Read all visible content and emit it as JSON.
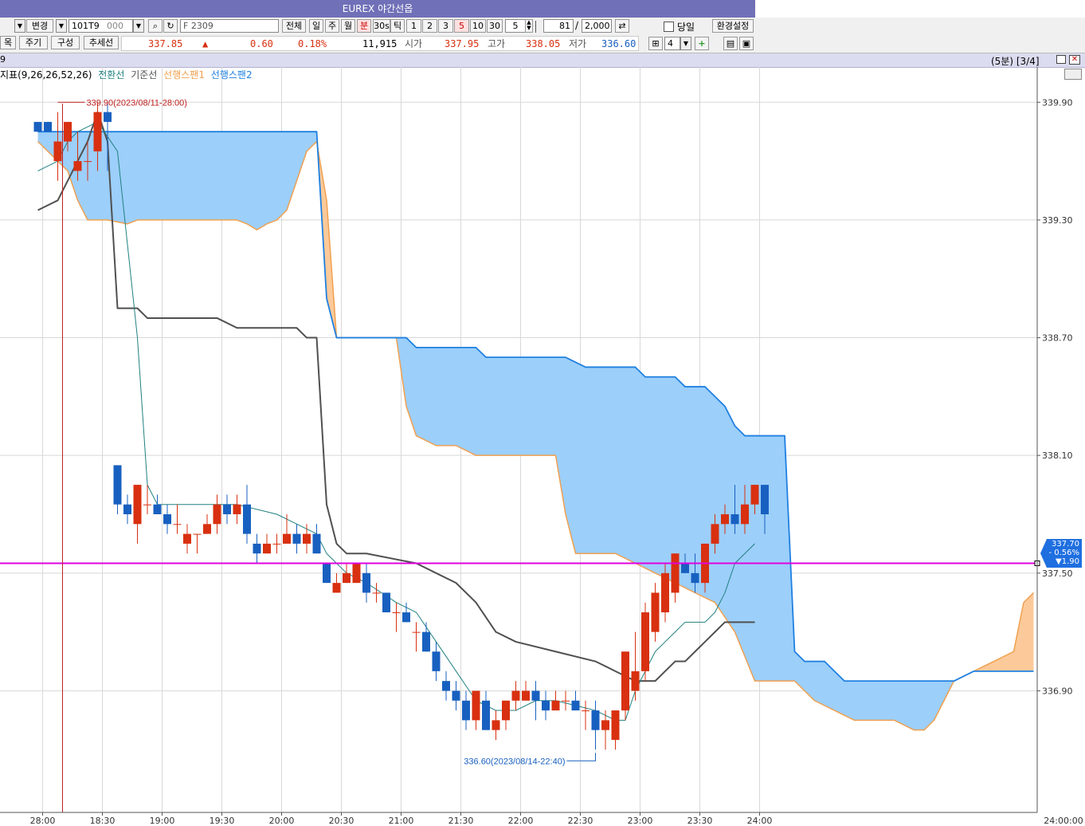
{
  "window": {
    "title": "EUREX 야간선옵"
  },
  "toolbar1": {
    "change_label": "변경",
    "code": "101T9",
    "code_suffix": "000",
    "contract": "F 2309",
    "all_label": "전체",
    "day_label": "일",
    "week_label": "주",
    "month_label": "월",
    "minute_label": "분",
    "sec30_label": "30s",
    "tick_label": "틱",
    "intervals": [
      "1",
      "2",
      "3",
      "5",
      "10",
      "30"
    ],
    "selected_interval": "5",
    "period_value": "5",
    "count_value": "81",
    "count_separator": "/",
    "total_value": "2,000",
    "sameday_label": "당일",
    "settings_label": "환경설정"
  },
  "toolbar2": {
    "item_label": "목",
    "period_label": "주기",
    "compose_label": "구성",
    "trend_label": "추세선",
    "price": "337.85",
    "direction_icon": "up-triangle",
    "change": "0.60",
    "change_pct": "0.18%",
    "volume": "11,915",
    "open_label": "시가",
    "open": "337.95",
    "high_label": "고가",
    "high": "338.05",
    "low_label": "저가",
    "low": "336.60",
    "layout_count": "4"
  },
  "chartbar": {
    "left_label": "9",
    "interval_info": "(5분) [3/4]"
  },
  "legend": {
    "indicator": "지표(9,26,26,52,26)",
    "conversion": "전환선",
    "base": "기준선",
    "span1": "선행스팬1",
    "span2": "선행스팬2"
  },
  "colors": {
    "up": "#d83010",
    "down": "#1860c0",
    "conversion": "#208080",
    "base": "#505050",
    "span1": "#f0a050",
    "span2": "#1f80e0",
    "cloud_bull": "#9ccffa",
    "cloud_bear": "#fcca9a",
    "hline": "#e000e0"
  },
  "annotations": {
    "high_label": "339.90(2023/08/11-28:00)",
    "low_label": "336.60(2023/08/14-22:40)"
  },
  "price_tag": {
    "price": "337.70",
    "pct": "- 0.56%",
    "change": "▼1.90"
  },
  "chart_data": {
    "type": "candlestick",
    "y_ticks": [
      "339.90",
      "339.30",
      "338.70",
      "338.10",
      "337.50",
      "336.90"
    ],
    "y_range": [
      336.28,
      340.08
    ],
    "x_ticks": [
      "28:00",
      "18:30",
      "19:00",
      "19:30",
      "20:00",
      "20:30",
      "21:00",
      "21:30",
      "22:00",
      "22:30",
      "23:00",
      "23:30",
      "24:00",
      "24:00:00"
    ],
    "hline": 337.55,
    "candles": [
      [
        339.8,
        339.8,
        339.75,
        339.75
      ],
      [
        339.8,
        339.8,
        339.75,
        339.75
      ],
      [
        339.6,
        339.85,
        339.5,
        339.7
      ],
      [
        339.7,
        339.8,
        339.65,
        339.8
      ],
      [
        339.55,
        339.75,
        339.5,
        339.6
      ],
      [
        339.6,
        339.7,
        339.5,
        339.6
      ],
      [
        339.65,
        339.9,
        339.55,
        339.85
      ],
      [
        339.85,
        339.9,
        339.55,
        339.8
      ],
      [
        338.05,
        338.05,
        337.8,
        337.85
      ],
      [
        337.85,
        337.9,
        337.75,
        337.8
      ],
      [
        337.75,
        337.95,
        337.65,
        337.95
      ],
      [
        337.85,
        337.95,
        337.8,
        337.85
      ],
      [
        337.85,
        337.9,
        337.8,
        337.8
      ],
      [
        337.8,
        337.85,
        337.7,
        337.75
      ],
      [
        337.75,
        337.85,
        337.7,
        337.75
      ],
      [
        337.65,
        337.75,
        337.6,
        337.7
      ],
      [
        337.7,
        337.7,
        337.6,
        337.7
      ],
      [
        337.7,
        337.8,
        337.7,
        337.75
      ],
      [
        337.75,
        337.9,
        337.7,
        337.85
      ],
      [
        337.85,
        337.9,
        337.75,
        337.8
      ],
      [
        337.8,
        337.9,
        337.75,
        337.85
      ],
      [
        337.85,
        337.95,
        337.65,
        337.7
      ],
      [
        337.65,
        337.7,
        337.55,
        337.6
      ],
      [
        337.6,
        337.7,
        337.6,
        337.65
      ],
      [
        337.65,
        337.7,
        337.6,
        337.65
      ],
      [
        337.65,
        337.8,
        337.65,
        337.7
      ],
      [
        337.7,
        337.75,
        337.6,
        337.65
      ],
      [
        337.65,
        337.75,
        337.6,
        337.7
      ],
      [
        337.7,
        337.75,
        337.6,
        337.6
      ],
      [
        337.55,
        337.55,
        337.45,
        337.45
      ],
      [
        337.4,
        337.5,
        337.4,
        337.45
      ],
      [
        337.45,
        337.55,
        337.45,
        337.5
      ],
      [
        337.45,
        337.55,
        337.45,
        337.55
      ],
      [
        337.5,
        337.55,
        337.35,
        337.4
      ],
      [
        337.4,
        337.45,
        337.35,
        337.4
      ],
      [
        337.4,
        337.4,
        337.3,
        337.3
      ],
      [
        337.3,
        337.35,
        337.2,
        337.3
      ],
      [
        337.3,
        337.35,
        337.25,
        337.25
      ],
      [
        337.2,
        337.25,
        337.1,
        337.2
      ],
      [
        337.2,
        337.25,
        337.1,
        337.1
      ],
      [
        337.1,
        337.15,
        336.95,
        337.0
      ],
      [
        336.95,
        337.0,
        336.85,
        336.9
      ],
      [
        336.9,
        336.95,
        336.8,
        336.85
      ],
      [
        336.85,
        336.9,
        336.7,
        336.75
      ],
      [
        336.75,
        336.9,
        336.7,
        336.9
      ],
      [
        336.85,
        336.9,
        336.7,
        336.7
      ],
      [
        336.7,
        336.8,
        336.65,
        336.75
      ],
      [
        336.75,
        336.85,
        336.7,
        336.85
      ],
      [
        336.85,
        336.95,
        336.8,
        336.9
      ],
      [
        336.85,
        336.95,
        336.85,
        336.9
      ],
      [
        336.9,
        336.95,
        336.75,
        336.85
      ],
      [
        336.85,
        336.9,
        336.75,
        336.8
      ],
      [
        336.8,
        336.9,
        336.8,
        336.85
      ],
      [
        336.85,
        336.9,
        336.8,
        336.85
      ],
      [
        336.85,
        336.9,
        336.8,
        336.8
      ],
      [
        336.8,
        336.85,
        336.7,
        336.8
      ],
      [
        336.8,
        336.85,
        336.6,
        336.7
      ],
      [
        336.7,
        336.8,
        336.6,
        336.75
      ],
      [
        336.65,
        336.8,
        336.6,
        336.8
      ],
      [
        336.8,
        337.1,
        336.75,
        337.1
      ],
      [
        336.9,
        337.2,
        336.85,
        337.0
      ],
      [
        337.0,
        337.35,
        336.95,
        337.3
      ],
      [
        337.2,
        337.45,
        337.15,
        337.4
      ],
      [
        337.3,
        337.55,
        337.25,
        337.5
      ],
      [
        337.4,
        337.6,
        337.35,
        337.6
      ],
      [
        337.55,
        337.6,
        337.5,
        337.5
      ],
      [
        337.5,
        337.6,
        337.4,
        337.45
      ],
      [
        337.45,
        337.65,
        337.4,
        337.65
      ],
      [
        337.65,
        337.8,
        337.6,
        337.75
      ],
      [
        337.75,
        337.85,
        337.7,
        337.8
      ],
      [
        337.8,
        337.95,
        337.7,
        337.75
      ],
      [
        337.75,
        337.95,
        337.7,
        337.85
      ],
      [
        337.85,
        337.95,
        337.8,
        337.95
      ],
      [
        337.95,
        337.95,
        337.7,
        337.8
      ]
    ],
    "conversion": [
      [
        0,
        339.55
      ],
      [
        2,
        339.6
      ],
      [
        3,
        339.7
      ],
      [
        4,
        339.75
      ],
      [
        6,
        339.8
      ],
      [
        8,
        339.65
      ],
      [
        10,
        338.7
      ],
      [
        11,
        337.95
      ],
      [
        12,
        337.85
      ],
      [
        20,
        337.85
      ],
      [
        24,
        337.8
      ],
      [
        26,
        337.75
      ],
      [
        28,
        337.7
      ],
      [
        29,
        337.6
      ],
      [
        31,
        337.5
      ],
      [
        33,
        337.45
      ],
      [
        36,
        337.35
      ],
      [
        38,
        337.3
      ],
      [
        40,
        337.15
      ],
      [
        42,
        337.0
      ],
      [
        44,
        336.85
      ],
      [
        46,
        336.8
      ],
      [
        48,
        336.8
      ],
      [
        50,
        336.85
      ],
      [
        52,
        336.85
      ],
      [
        56,
        336.8
      ],
      [
        58,
        336.75
      ],
      [
        59,
        336.75
      ],
      [
        60,
        336.9
      ],
      [
        61,
        337.0
      ],
      [
        62,
        337.1
      ],
      [
        63,
        337.15
      ],
      [
        64,
        337.2
      ],
      [
        65,
        337.25
      ],
      [
        66,
        337.25
      ],
      [
        67,
        337.25
      ],
      [
        68,
        337.3
      ],
      [
        69,
        337.4
      ],
      [
        70,
        337.55
      ],
      [
        71,
        337.6
      ],
      [
        72,
        337.65
      ]
    ],
    "base": [
      [
        0,
        339.35
      ],
      [
        2,
        339.4
      ],
      [
        3,
        339.5
      ],
      [
        4,
        339.6
      ],
      [
        5,
        339.7
      ],
      [
        6,
        339.85
      ],
      [
        7,
        339.7
      ],
      [
        8,
        338.85
      ],
      [
        9,
        338.85
      ],
      [
        10,
        338.85
      ],
      [
        11,
        338.8
      ],
      [
        12,
        338.8
      ],
      [
        18,
        338.8
      ],
      [
        20,
        338.75
      ],
      [
        25,
        338.75
      ],
      [
        26,
        338.75
      ],
      [
        27,
        338.7
      ],
      [
        28,
        338.7
      ],
      [
        29,
        337.85
      ],
      [
        30,
        337.65
      ],
      [
        31,
        337.6
      ],
      [
        33,
        337.6
      ],
      [
        38,
        337.55
      ],
      [
        40,
        337.5
      ],
      [
        42,
        337.45
      ],
      [
        44,
        337.35
      ],
      [
        46,
        337.2
      ],
      [
        48,
        337.15
      ],
      [
        52,
        337.1
      ],
      [
        56,
        337.05
      ],
      [
        58,
        337.0
      ],
      [
        60,
        336.95
      ],
      [
        61,
        336.95
      ],
      [
        62,
        336.95
      ],
      [
        63,
        337.0
      ],
      [
        64,
        337.05
      ],
      [
        65,
        337.05
      ],
      [
        66,
        337.1
      ],
      [
        67,
        337.15
      ],
      [
        68,
        337.2
      ],
      [
        69,
        337.25
      ],
      [
        70,
        337.25
      ],
      [
        71,
        337.25
      ],
      [
        72,
        337.25
      ]
    ],
    "span1": [
      [
        0,
        339.7
      ],
      [
        2,
        339.6
      ],
      [
        3,
        339.55
      ],
      [
        4,
        339.4
      ],
      [
        5,
        339.3
      ],
      [
        7,
        339.3
      ],
      [
        9,
        339.28
      ],
      [
        10,
        339.3
      ],
      [
        14,
        339.3
      ],
      [
        18,
        339.3
      ],
      [
        19,
        339.3
      ],
      [
        20,
        339.3
      ],
      [
        21,
        339.28
      ],
      [
        22,
        339.25
      ],
      [
        23,
        339.28
      ],
      [
        24,
        339.3
      ],
      [
        25,
        339.35
      ],
      [
        26,
        339.5
      ],
      [
        27,
        339.65
      ],
      [
        28,
        339.7
      ],
      [
        29,
        339.4
      ],
      [
        30,
        338.7
      ],
      [
        31,
        338.7
      ],
      [
        36,
        338.7
      ],
      [
        37,
        338.35
      ],
      [
        38,
        338.2
      ],
      [
        40,
        338.15
      ],
      [
        42,
        338.15
      ],
      [
        44,
        338.1
      ],
      [
        46,
        338.1
      ],
      [
        48,
        338.1
      ],
      [
        52,
        338.1
      ],
      [
        53,
        337.8
      ],
      [
        54,
        337.6
      ],
      [
        56,
        337.6
      ],
      [
        58,
        337.6
      ],
      [
        60,
        337.55
      ],
      [
        62,
        337.5
      ],
      [
        64,
        337.45
      ],
      [
        66,
        337.4
      ],
      [
        68,
        337.35
      ],
      [
        70,
        337.2
      ],
      [
        72,
        336.95
      ],
      [
        74,
        336.95
      ],
      [
        76,
        336.95
      ],
      [
        78,
        336.85
      ],
      [
        80,
        336.8
      ],
      [
        82,
        336.75
      ],
      [
        84,
        336.75
      ],
      [
        86,
        336.75
      ],
      [
        88,
        336.7
      ],
      [
        89,
        336.7
      ],
      [
        90,
        336.75
      ],
      [
        91,
        336.85
      ],
      [
        92,
        336.95
      ],
      [
        94,
        337.0
      ],
      [
        96,
        337.05
      ],
      [
        98,
        337.1
      ],
      [
        99,
        337.35
      ],
      [
        100,
        337.4
      ]
    ],
    "span2": [
      [
        0,
        339.75
      ],
      [
        28,
        339.75
      ],
      [
        29,
        338.9
      ],
      [
        30,
        338.7
      ],
      [
        31,
        338.7
      ],
      [
        32,
        338.7
      ],
      [
        33,
        338.7
      ],
      [
        36,
        338.7
      ],
      [
        37,
        338.7
      ],
      [
        38,
        338.65
      ],
      [
        39,
        338.65
      ],
      [
        44,
        338.65
      ],
      [
        45,
        338.6
      ],
      [
        48,
        338.6
      ],
      [
        53,
        338.6
      ],
      [
        55,
        338.55
      ],
      [
        57,
        338.55
      ],
      [
        60,
        338.55
      ],
      [
        61,
        338.5
      ],
      [
        62,
        338.5
      ],
      [
        64,
        338.5
      ],
      [
        65,
        338.45
      ],
      [
        66,
        338.45
      ],
      [
        67,
        338.45
      ],
      [
        68,
        338.4
      ],
      [
        69,
        338.35
      ],
      [
        70,
        338.25
      ],
      [
        71,
        338.2
      ],
      [
        72,
        338.2
      ],
      [
        74,
        338.2
      ],
      [
        75,
        338.2
      ],
      [
        76,
        337.1
      ],
      [
        77,
        337.05
      ],
      [
        78,
        337.05
      ],
      [
        79,
        337.05
      ],
      [
        80,
        337.0
      ],
      [
        81,
        336.95
      ],
      [
        84,
        336.95
      ],
      [
        86,
        336.95
      ],
      [
        88,
        336.95
      ],
      [
        90,
        336.95
      ],
      [
        92,
        336.95
      ],
      [
        94,
        337.0
      ],
      [
        96,
        337.0
      ],
      [
        98,
        337.0
      ],
      [
        99,
        337.0
      ],
      [
        100,
        337.0
      ]
    ],
    "markers": [
      {
        "kind": "high",
        "index": 2,
        "value": 339.9
      },
      {
        "kind": "low",
        "index": 56,
        "value": 336.6
      }
    ]
  }
}
